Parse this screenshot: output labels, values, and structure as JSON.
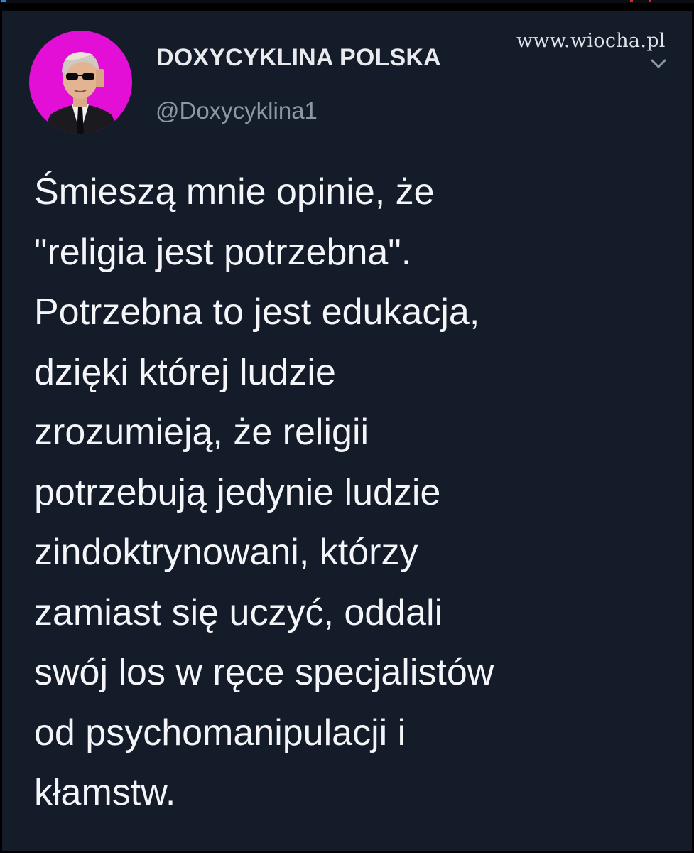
{
  "watermark": {
    "text": "www.wiocha.pl"
  },
  "tweet": {
    "author": {
      "display_name": "DOXYCYKLINA POLSKA",
      "handle": "@Doxycyklina1",
      "avatar_bg_color": "#e40fd6"
    },
    "more_icon": "chevron-down-icon",
    "text_lines": [
      "Śmieszą mnie opinie, że",
      "\"religia jest potrzebna\".",
      "Potrzebna to jest edukacja,",
      "dzięki której ludzie",
      "zrozumieją, że religii",
      "potrzebują jedynie ludzie",
      "zindoktrynowani, którzy",
      "zamiast się uczyć, oddali",
      "swój los w ręce specjalistów",
      "od psychomanipulacji i",
      "kłamstw."
    ]
  },
  "colors": {
    "card_background": "#151c29",
    "text_primary": "#f3f5f8",
    "text_secondary": "#8b97a4"
  }
}
